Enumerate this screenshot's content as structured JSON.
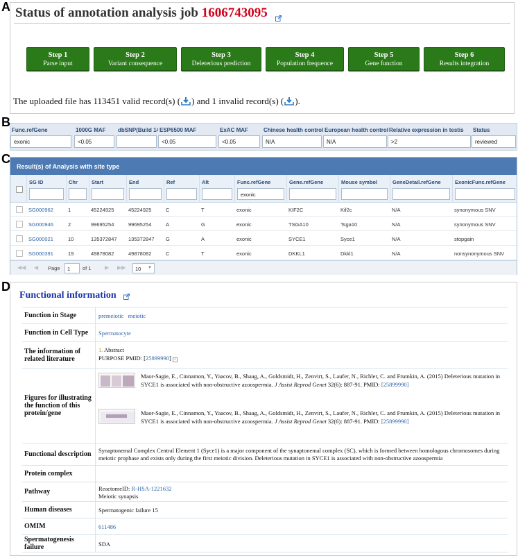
{
  "panel_labels": {
    "a": "A",
    "b": "B",
    "c": "C",
    "d": "D"
  },
  "job": {
    "title": "Status of annotation analysis job",
    "id": "1606743095"
  },
  "steps": [
    {
      "num": "Step 1",
      "desc": "Parse input"
    },
    {
      "num": "Step 2",
      "desc": "Variant consequence"
    },
    {
      "num": "Step 3",
      "desc": "Deleterious prediction"
    },
    {
      "num": "Step 4",
      "desc": "Population frequence"
    },
    {
      "num": "Step 5",
      "desc": "Gene function"
    },
    {
      "num": "Step 6",
      "desc": "Results integration"
    }
  ],
  "upload": {
    "pre": "The uploaded file has 113451 valid record(s) (",
    "mid": ") and 1 invalid record(s) (",
    "post": ")."
  },
  "filters": [
    {
      "header": "Func.refGene",
      "value": "exonic"
    },
    {
      "header": "1000G MAF",
      "value": "<0.05"
    },
    {
      "header": "dbSNP(Build 142",
      "value": ""
    },
    {
      "header": "ESP6500 MAF",
      "value": "<0.05"
    },
    {
      "header": "ExAC MAF",
      "value": "<0.05"
    },
    {
      "header": "Chinese health control",
      "value": "N/A"
    },
    {
      "header": "European health control",
      "value": "N/A"
    },
    {
      "header": "Relative expression in testis",
      "value": ">2"
    },
    {
      "header": "Status",
      "value": "reviewed"
    }
  ],
  "results": {
    "caption": "Result(s) of Analysis with site type",
    "columns": [
      "SG ID",
      "Chr",
      "Start",
      "End",
      "Ref",
      "Alt",
      "Func.refGene",
      "Gene.refGene",
      "Mouse symbol",
      "GeneDetail.refGene",
      "ExonicFunc.refGene"
    ],
    "filter_values": [
      "",
      "",
      "",
      "",
      "",
      "",
      "exonic",
      "",
      "",
      "",
      ""
    ],
    "rows": [
      [
        "SG000962",
        "1",
        "45224925",
        "45224925",
        "C",
        "T",
        "exonic",
        "KIF2C",
        "Kif2c",
        "N/A",
        "synonymous SNV"
      ],
      [
        "SG000946",
        "2",
        "99695254",
        "99695254",
        "A",
        "G",
        "exonic",
        "TSGA10",
        "Tsga10",
        "N/A",
        "synonymous SNV"
      ],
      [
        "SG000021",
        "10",
        "135372847",
        "135372847",
        "G",
        "A",
        "exonic",
        "SYCE1",
        "Syce1",
        "N/A",
        "stopgain"
      ],
      [
        "SG000391",
        "19",
        "49878082",
        "49878082",
        "C",
        "T",
        "exonic",
        "DKKL1",
        "Dkkl1",
        "N/A",
        "nonsynonymous SNV"
      ]
    ],
    "pager": {
      "page_label": "Page",
      "page": "1",
      "of": "of 1",
      "per_page": "10"
    }
  },
  "functional": {
    "title": "Functional information",
    "stage_label": "Function in Stage",
    "stages": [
      "premeiotic",
      "meiotic"
    ],
    "cell_label": "Function in Cell Type",
    "cell": "Spermatocyte",
    "lit_label": "The information of related literature",
    "lit_num": "1.",
    "lit_abstract": "Abstract",
    "lit_purpose": "PURPOSE PMID: [",
    "lit_pmid": "25899990",
    "lit_close": "]",
    "figs_label": "Figures for illustrating the function of this protein/gene",
    "ref_text": "Maor-Sagie, E., Cinnamon, Y., Yaacov, B., Shaag, A., Goldsmidt, H., Zenvirt, S., Laufer, N., Richler, C. and Frumkin, A. (2015) Deleterious mutation in SYCE1 is associated with non-obstructive azoospermia.",
    "ref_journal": "J Assist Reprod Genet",
    "ref_tail": "32(6): 887-91. PMID:",
    "ref_pmid": "[25899990]",
    "desc_label": "Functional description",
    "desc": "Synaptonemal Complex Central Element 1 (Syce1) is a major component of the synaptonemal complex (SC), which is formed between homologous chromosomes during meiotic prophase and exists only during the first meiotic division. Deleterious mutation in SYCE1 is associated with non-obstructive azoospermia",
    "complex_label": "Protein complex",
    "pathway_label": "Pathway",
    "pathway_prefix": "ReactomeID:",
    "pathway_id": "R-HSA-1221632",
    "pathway_name": "Meiotic synapsis",
    "disease_label": "Human diseases",
    "disease": "Spermatogenic failure 15",
    "omim_label": "OMIM",
    "omim": "611486",
    "sf_label": "Spermatogenesis failure",
    "sf": "SDA"
  }
}
